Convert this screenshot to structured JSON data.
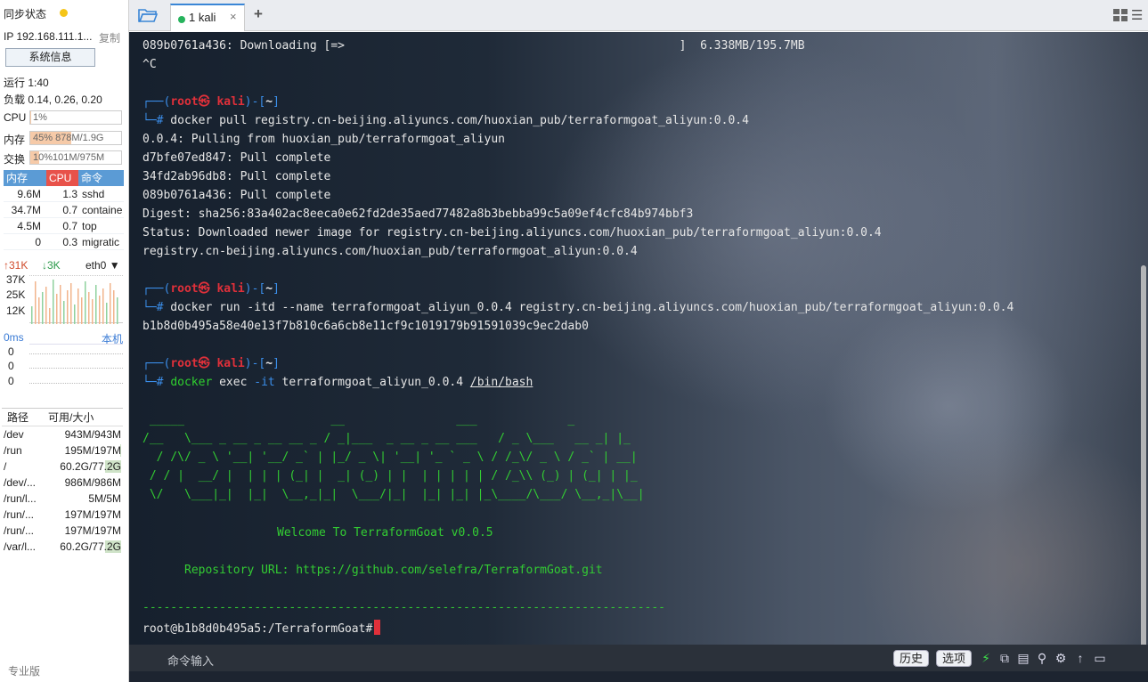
{
  "sidebar": {
    "sync_title": "同步状态",
    "ip": "IP 192.168.111.1...",
    "copy": "复制",
    "sysinfo": "系统信息",
    "uptime": "运行 1:40",
    "load": "负载 0.14, 0.26, 0.20",
    "cpu": {
      "label": "CPU",
      "text": "1%",
      "fraction": 0.01
    },
    "mem": {
      "label": "内存",
      "text": "45%  878M/1.9G",
      "fraction": 0.45
    },
    "swap": {
      "label": "交换",
      "text": "10%101M/975M",
      "fraction": 0.1
    },
    "proc_headers": [
      "内存",
      "CPU",
      "命令"
    ],
    "processes": [
      {
        "mem": "9.6M",
        "cpu": "1.3",
        "cmd": "sshd"
      },
      {
        "mem": "34.7M",
        "cpu": "0.7",
        "cmd": "containe"
      },
      {
        "mem": "4.5M",
        "cpu": "0.7",
        "cmd": "top"
      },
      {
        "mem": "0",
        "cpu": "0.3",
        "cmd": "migratic"
      }
    ],
    "net": {
      "up": "31K",
      "down": "3K",
      "iface": "eth0",
      "y_labels": [
        "37K",
        "25K",
        "12K"
      ]
    },
    "latency": {
      "label": "0ms",
      "host": "本机",
      "values": [
        "0",
        "0",
        "0"
      ]
    },
    "disk_headers": [
      "路径",
      "可用/大小"
    ],
    "disks": [
      {
        "path": "/dev",
        "size": "943M/943M",
        "used": 0.0
      },
      {
        "path": "/run",
        "size": "195M/197M",
        "used": 0.01
      },
      {
        "path": "/",
        "size": "60.2G/77.2G",
        "used": 0.22
      },
      {
        "path": "/dev/...",
        "size": "986M/986M",
        "used": 0.0
      },
      {
        "path": "/run/l...",
        "size": "5M/5M",
        "used": 0.0
      },
      {
        "path": "/run/...",
        "size": "197M/197M",
        "used": 0.0
      },
      {
        "path": "/run/...",
        "size": "197M/197M",
        "used": 0.0
      },
      {
        "path": "/var/l...",
        "size": "60.2G/77.2G",
        "used": 0.22
      }
    ],
    "edition": "专业版"
  },
  "tabs": [
    {
      "label": "1 kali",
      "close": "×"
    }
  ],
  "terminal": {
    "dl_line": "089b0761a436: Downloading [=>                                                ]  6.338MB/195.7MB",
    "ctrl_c": "^C",
    "prompt_open": "┌──(",
    "prompt_user": "root㉿ kali",
    "prompt_mid": ")-[",
    "prompt_dir": "~",
    "prompt_close": "]",
    "prompt_hash": "└─#",
    "cmd_pull": " docker pull registry.cn-beijing.aliyuncs.com/huoxian_pub/terraformgoat_aliyun:0.0.4",
    "pull_out": [
      "0.0.4: Pulling from huoxian_pub/terraformgoat_aliyun",
      "d7bfe07ed847: Pull complete",
      "34fd2ab96db8: Pull complete",
      "089b0761a436: Pull complete",
      "Digest: sha256:83a402ac8eeca0e62fd2de35aed77482a8b3bebba99c5a09ef4cfc84b974bbf3",
      "Status: Downloaded newer image for registry.cn-beijing.aliyuncs.com/huoxian_pub/terraformgoat_aliyun:0.0.4",
      "registry.cn-beijing.aliyuncs.com/huoxian_pub/terraformgoat_aliyun:0.0.4"
    ],
    "cmd_run": " docker run -itd --name terraformgoat_aliyun_0.0.4 registry.cn-beijing.aliyuncs.com/huoxian_pub/terraformgoat_aliyun:0.0.4",
    "container_id": "b1b8d0b495a58e40e13f7b810c6a6cb8e11cf9c1019179b91591039c9ec2dab0",
    "exec_cmd": "docker",
    "exec_sub": " exec ",
    "exec_flag": "-it",
    "exec_name": " terraformgoat_aliyun_0.0.4 ",
    "exec_path": "/bin/bash",
    "banner": [
      " _____                     __                ___             _",
      "/__   \\___ _ __ _ __ __ _ / _|___  _ __ _ __ ___   / _ \\___   __ _| |_",
      "  / /\\/ _ \\ '__| '__/ _` | |_/ _ \\| '__| '_ ` _ \\ / /_\\/ _ \\ / _` | __|",
      " / / |  __/ |  | | | (_| |  _| (_) | |  | | | | | / /_\\\\ (_) | (_| | |_",
      " \\/   \\___|_|  |_|  \\__,_|_|  \\___/|_|  |_| |_| |_\\____/\\___/ \\__,_|\\__|"
    ],
    "welcome": "Welcome To TerraformGoat v0.0.5",
    "repo": "Repository URL: https://github.com/selefra/TerraformGoat.git",
    "divider": "---------------------------------------------------------------------------",
    "final_prompt": "root@b1b8d0b495a5:/TerraformGoat#"
  },
  "cmdbar": {
    "label": "命令输入",
    "history": "历史",
    "options": "选项"
  }
}
